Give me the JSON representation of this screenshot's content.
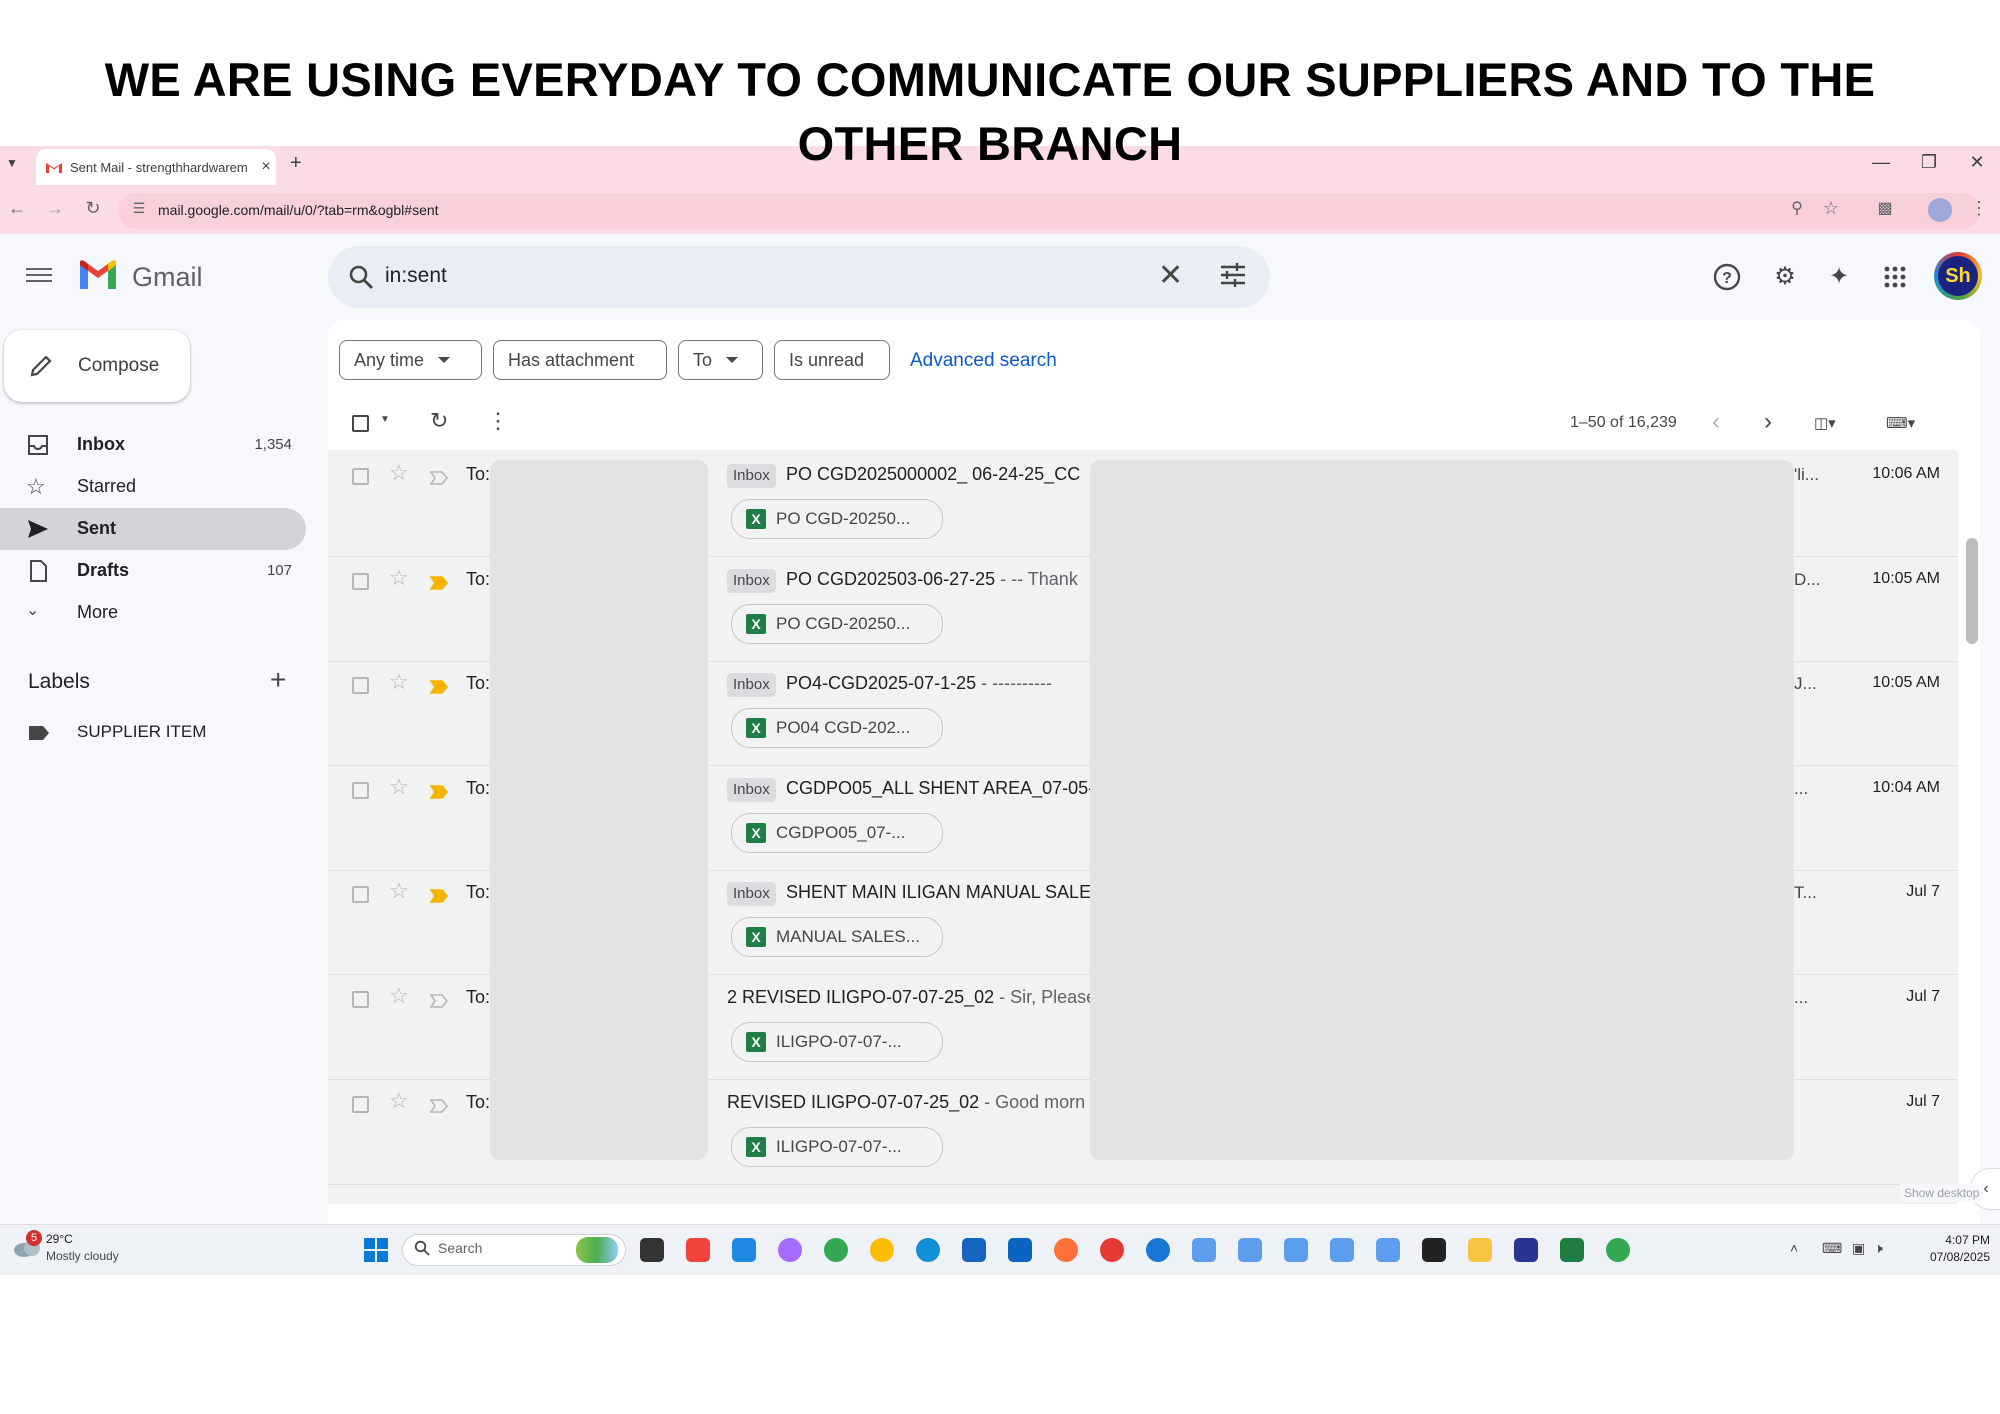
{
  "headline": "WE ARE USING EVERYDAY TO COMMUNICATE OUR SUPPLIERS AND TO THE OTHER BRANCH",
  "browser": {
    "tab_title": "Sent Mail - strengthhardwarem",
    "url": "mail.google.com/mail/u/0/?tab=rm&ogbl#sent"
  },
  "gmail": {
    "brand": "Gmail",
    "search_value": "in:sent",
    "compose_label": "Compose",
    "nav": [
      {
        "label": "Inbox",
        "count": "1,354",
        "icon": "inbox-icon"
      },
      {
        "label": "Starred",
        "count": "",
        "icon": "star-icon"
      },
      {
        "label": "Sent",
        "count": "",
        "icon": "send-icon"
      },
      {
        "label": "Drafts",
        "count": "107",
        "icon": "draft-icon"
      },
      {
        "label": "More",
        "count": "",
        "icon": "chevron-down-icon"
      }
    ],
    "labels_title": "Labels",
    "labels": [
      "SUPPLIER ITEM"
    ],
    "filters": [
      "Any time",
      "Has attachment",
      "To",
      "Is unread"
    ],
    "advanced_search": "Advanced search",
    "pager": "1–50 of 16,239",
    "accent_color": "#0b57d0",
    "rows": [
      {
        "to": "To:",
        "tag": "Inbox",
        "subject": "PO CGD2025000002_ 06-24-25_CC",
        "snippet": "",
        "attachment": "PO CGD-20250...",
        "tail": "'li...",
        "date": "10:06 AM",
        "important": false
      },
      {
        "to": "To:",
        "tag": "Inbox",
        "subject": "PO CGD202503-06-27-25",
        "snippet": " - -- Thank",
        "attachment": "PO CGD-20250...",
        "tail": "D...",
        "date": "10:05 AM",
        "important": true
      },
      {
        "to": "To:",
        "tag": "Inbox",
        "subject": "PO4-CGD2025-07-1-25",
        "snippet": " - ----------",
        "attachment": "PO04 CGD-202...",
        "tail": "J...",
        "date": "10:05 AM",
        "important": true
      },
      {
        "to": "To:",
        "tag": "Inbox",
        "subject": "CGDPO05_ALL SHENT AREA_07-05-",
        "snippet": "",
        "attachment": "CGDPO05_07-...",
        "tail": "...",
        "date": "10:04 AM",
        "important": true
      },
      {
        "to": "To:",
        "tag": "Inbox",
        "subject": "SHENT MAIN ILIGAN MANUAL SALES",
        "snippet": "",
        "attachment": "MANUAL SALES...",
        "tail": "T...",
        "date": "Jul 7",
        "important": true
      },
      {
        "to": "To:",
        "tag": "",
        "subject": "2 REVISED ILIGPO-07-07-25_02",
        "snippet": " - Sir, Please",
        "attachment": "ILIGPO-07-07-...",
        "tail": "...",
        "date": "Jul 7",
        "important": false
      },
      {
        "to": "To:",
        "tag": "",
        "subject": "REVISED ILIGPO-07-07-25_02",
        "snippet": " - Good morn",
        "attachment": "ILIGPO-07-07-...",
        "tail": "",
        "date": "Jul 7",
        "important": false
      }
    ],
    "show_desktop": "Show desktop"
  },
  "taskbar": {
    "weather_badge": "5",
    "temperature": "29°C",
    "condition": "Mostly cloudy",
    "search_label": "Search",
    "time": "4:07 PM",
    "date": "07/08/2025"
  }
}
